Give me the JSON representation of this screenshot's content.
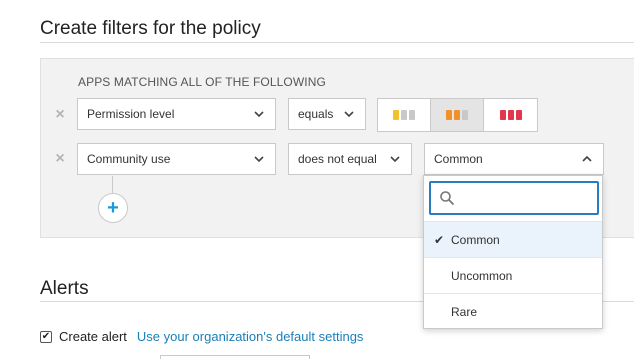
{
  "policy_section": {
    "title": "Create filters for the policy"
  },
  "filter_panel": {
    "heading": "APPS MATCHING ALL OF THE FOLLOWING",
    "rows": [
      {
        "field": "Permission level",
        "operator": "equals",
        "levels": [
          {
            "name": "low",
            "color": "#f2c12e",
            "muted": "#c8c8c8",
            "filled": 1
          },
          {
            "name": "medium",
            "color": "#f0912a",
            "muted": "#c8c8c8",
            "filled": 2
          },
          {
            "name": "high",
            "color": "#e2364f",
            "muted": "#c8c8c8",
            "filled": 3
          }
        ],
        "selected_level": "medium"
      },
      {
        "field": "Community use",
        "operator": "does not equal",
        "value": "Common"
      }
    ]
  },
  "dropdown": {
    "search_placeholder": "",
    "options": [
      {
        "label": "Common",
        "selected": true
      },
      {
        "label": "Uncommon",
        "selected": false
      },
      {
        "label": "Rare",
        "selected": false
      }
    ]
  },
  "alerts_section": {
    "title": "Alerts",
    "create_alert_label": "Create alert",
    "create_alert_checked": true,
    "default_settings_link": "Use your organization's default settings"
  },
  "colors": {
    "accent": "#1a9bd7",
    "link": "#1a7fb8",
    "focus": "#2b7bbf"
  }
}
